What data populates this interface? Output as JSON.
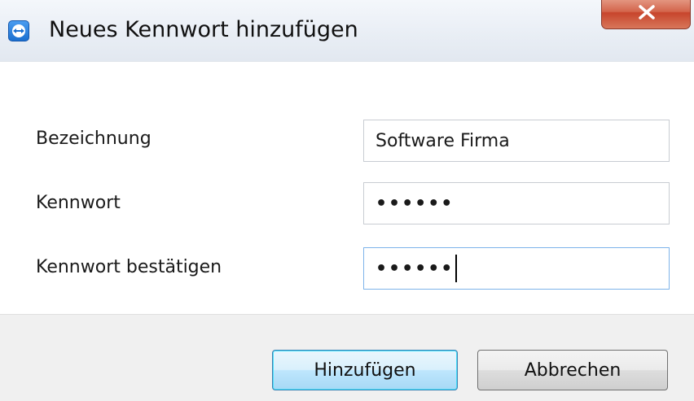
{
  "window": {
    "title": "Neues Kennwort hinzufügen",
    "icon": "teamviewer-icon",
    "close_icon": "close-icon"
  },
  "form": {
    "name_label": "Bezeichnung",
    "name_value": "Software Firma",
    "password_label": "Kennwort",
    "password_value": "••••••",
    "confirm_label": "Kennwort bestätigen",
    "confirm_value": "••••••"
  },
  "buttons": {
    "add_label": "Hinzufügen",
    "cancel_label": "Abbrechen"
  },
  "colors": {
    "close_button": "#c7452c",
    "focus_border": "#7eb4ea",
    "default_button": "#3c7fb1"
  }
}
